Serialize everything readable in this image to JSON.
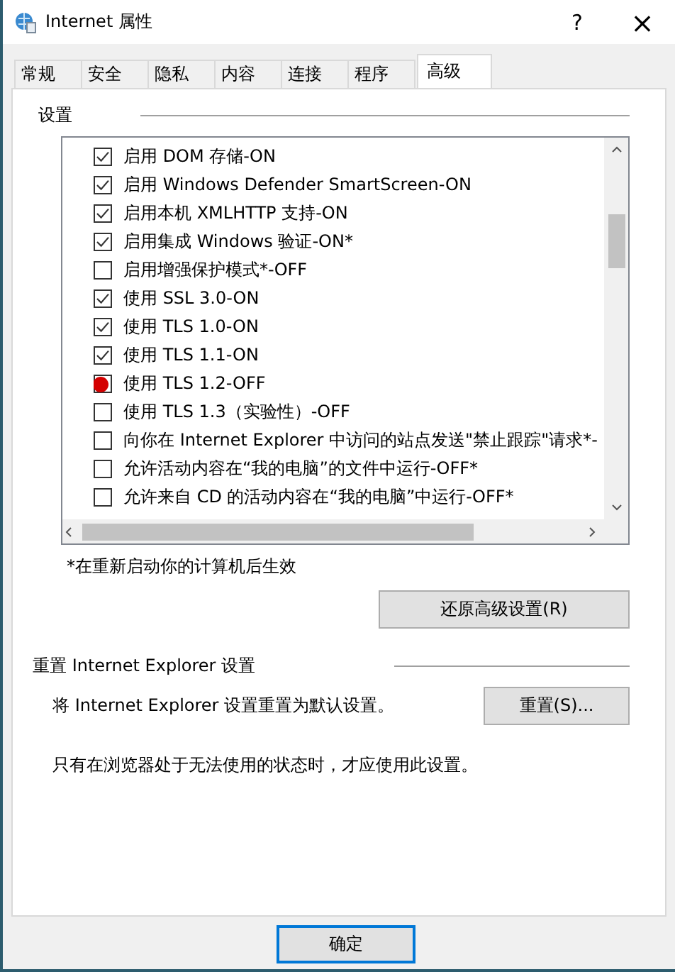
{
  "window": {
    "title": "Internet 属性",
    "help": "?",
    "close": "×"
  },
  "tabs": [
    {
      "label": "常规",
      "selected": false
    },
    {
      "label": "安全",
      "selected": false
    },
    {
      "label": "隐私",
      "selected": false
    },
    {
      "label": "内容",
      "selected": false
    },
    {
      "label": "连接",
      "selected": false
    },
    {
      "label": "程序",
      "selected": false
    },
    {
      "label": "高级",
      "selected": true
    }
  ],
  "settings": {
    "title": "设置",
    "items": [
      {
        "label": "启用 DOM 存储-ON",
        "checked": true,
        "highlighted": false
      },
      {
        "label": "启用 Windows Defender SmartScreen-ON",
        "checked": true,
        "highlighted": false
      },
      {
        "label": "启用本机 XMLHTTP 支持-ON",
        "checked": true,
        "highlighted": false
      },
      {
        "label": "启用集成 Windows 验证-ON*",
        "checked": true,
        "highlighted": false
      },
      {
        "label": "启用增强保护模式*-OFF",
        "checked": false,
        "highlighted": false
      },
      {
        "label": "使用 SSL 3.0-ON",
        "checked": true,
        "highlighted": false
      },
      {
        "label": "使用 TLS 1.0-ON",
        "checked": true,
        "highlighted": false
      },
      {
        "label": "使用 TLS 1.1-ON",
        "checked": true,
        "highlighted": false
      },
      {
        "label": "使用 TLS 1.2-OFF",
        "checked": false,
        "highlighted": true
      },
      {
        "label": "使用 TLS 1.3（实验性）-OFF",
        "checked": false,
        "highlighted": false
      },
      {
        "label": "向你在 Internet Explorer 中访问的站点发送\"禁止跟踪\"请求*-",
        "checked": false,
        "highlighted": false
      },
      {
        "label": "允许活动内容在“我的电脑”的文件中运行-OFF*",
        "checked": false,
        "highlighted": false
      },
      {
        "label": "允许来自 CD 的活动内容在“我的电脑”中运行-OFF*",
        "checked": false,
        "highlighted": false
      }
    ],
    "note": "*在重新启动你的计算机后生效",
    "restore_button": "还原高级设置(R)"
  },
  "reset": {
    "title": "重置 Internet Explorer 设置",
    "description": "将 Internet Explorer 设置重置为默认设置。",
    "button": "重置(S)...",
    "warning": "只有在浏览器处于无法使用的状态时，才应使用此设置。"
  },
  "buttons": [
    {
      "label": "确定",
      "default": true
    }
  ]
}
